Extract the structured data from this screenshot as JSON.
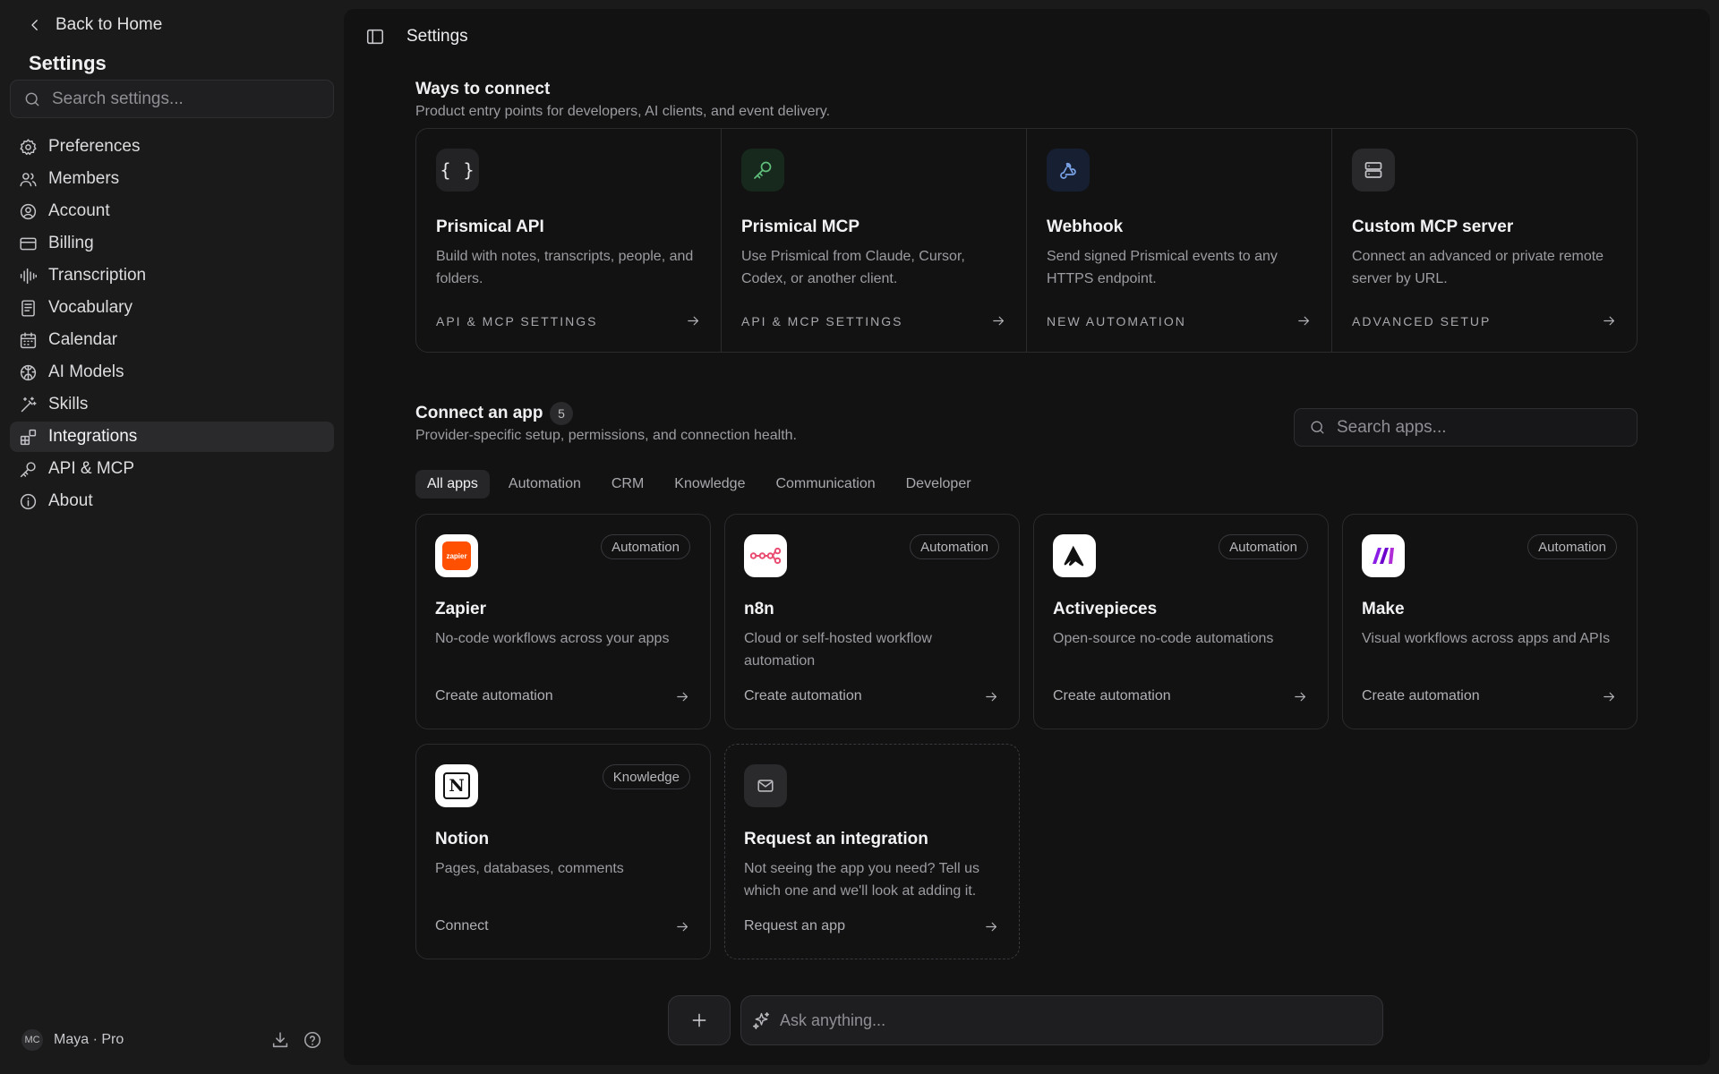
{
  "sidebar": {
    "back_label": "Back to Home",
    "title": "Settings",
    "search_placeholder": "Search settings...",
    "items": [
      {
        "label": "Preferences",
        "icon": "gear-icon"
      },
      {
        "label": "Members",
        "icon": "users-icon"
      },
      {
        "label": "Account",
        "icon": "user-circle-icon"
      },
      {
        "label": "Billing",
        "icon": "credit-card-icon"
      },
      {
        "label": "Transcription",
        "icon": "audio-waveform-icon"
      },
      {
        "label": "Vocabulary",
        "icon": "book-icon"
      },
      {
        "label": "Calendar",
        "icon": "calendar-icon"
      },
      {
        "label": "AI Models",
        "icon": "brain-icon"
      },
      {
        "label": "Skills",
        "icon": "magic-wand-icon"
      },
      {
        "label": "Integrations",
        "icon": "blocks-icon",
        "active": true
      },
      {
        "label": "API & MCP",
        "icon": "key-icon"
      },
      {
        "label": "About",
        "icon": "info-icon"
      }
    ],
    "user": {
      "initials": "MC",
      "name": "Maya",
      "separator": "·",
      "plan": "Pro"
    }
  },
  "header": {
    "title": "Settings"
  },
  "ways": {
    "title": "Ways to connect",
    "subtitle": "Product entry points for developers, AI clients, and event delivery.",
    "cards": [
      {
        "title": "Prismical API",
        "desc": "Build with notes, transcripts, people, and folders.",
        "link": "API & MCP SETTINGS",
        "icon": "braces-icon",
        "icon_text": "{ }",
        "icon_bg": "#232326",
        "icon_color": "#e6e6e8"
      },
      {
        "title": "Prismical MCP",
        "desc": "Use Prismical from Claude, Cursor, Codex, or another client.",
        "link": "API & MCP SETTINGS",
        "icon": "key-icon",
        "icon_bg": "#17281d",
        "icon_color": "#5fbf7a"
      },
      {
        "title": "Webhook",
        "desc": "Send signed Prismical events to any HTTPS endpoint.",
        "link": "NEW AUTOMATION",
        "icon": "webhook-icon",
        "icon_bg": "#172033",
        "icon_color": "#7aa3e8"
      },
      {
        "title": "Custom MCP server",
        "desc": "Connect an advanced or private remote server by URL.",
        "link": "ADVANCED SETUP",
        "icon": "server-icon",
        "icon_bg": "#29292c",
        "icon_color": "#c4c4c8"
      }
    ]
  },
  "apps": {
    "title": "Connect an app",
    "count": "5",
    "subtitle": "Provider-specific setup, permissions, and connection health.",
    "search_placeholder": "Search apps...",
    "tabs": [
      {
        "label": "All apps",
        "active": true
      },
      {
        "label": "Automation"
      },
      {
        "label": "CRM"
      },
      {
        "label": "Knowledge"
      },
      {
        "label": "Communication"
      },
      {
        "label": "Developer"
      }
    ],
    "cards": [
      {
        "title": "Zapier",
        "tag": "Automation",
        "desc": "No-code workflows across your apps",
        "link": "Create automation",
        "logo": "zapier-logo",
        "logo_text": "zapier",
        "accent": "#ff4f00"
      },
      {
        "title": "n8n",
        "tag": "Automation",
        "desc": "Cloud or self-hosted workflow automation",
        "link": "Create automation",
        "logo": "n8n-logo",
        "accent": "#ea4b71"
      },
      {
        "title": "Activepieces",
        "tag": "Automation",
        "desc": "Open-source no-code automations",
        "link": "Create automation",
        "logo": "activepieces-logo",
        "accent": "#111111"
      },
      {
        "title": "Make",
        "tag": "Automation",
        "desc": "Visual workflows across apps and APIs",
        "link": "Create automation",
        "logo": "make-logo",
        "accent": "#6d00cc"
      },
      {
        "title": "Notion",
        "tag": "Knowledge",
        "desc": "Pages, databases, comments",
        "link": "Connect",
        "logo": "notion-logo",
        "logo_text": "N",
        "accent": "#111111"
      }
    ],
    "request": {
      "title": "Request an integration",
      "desc": "Not seeing the app you need? Tell us which one and we'll look at adding it.",
      "link": "Request an app",
      "icon": "mail-icon"
    }
  },
  "chat": {
    "placeholder": "Ask anything...",
    "add_icon": "plus-icon",
    "sparkle_icon": "sparkle-icon"
  }
}
